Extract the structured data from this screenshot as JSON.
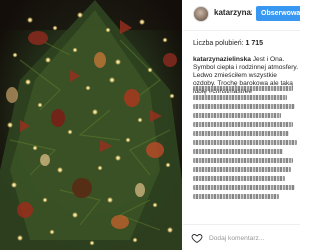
{
  "post": {
    "username": "katarzynazi...",
    "follow_label": "Obserwowanie",
    "likes_label": "Liczba polubień:",
    "likes_count": "1 715",
    "caption_author": "katarzynazielinska",
    "caption_text": " Jest i Ona. Symbol ciepła i rodzinnej atmosfery. Ledwo zmieściłem wszystkie ozdoby. Trochę barokowa ale taką lubię #christmastree"
  },
  "comment_box": {
    "placeholder": "Dodaj komentarz..."
  },
  "colors": {
    "follow_button": "#3897f0",
    "photo_background": "#1a140f"
  },
  "icons": {
    "like": "heart-icon"
  }
}
